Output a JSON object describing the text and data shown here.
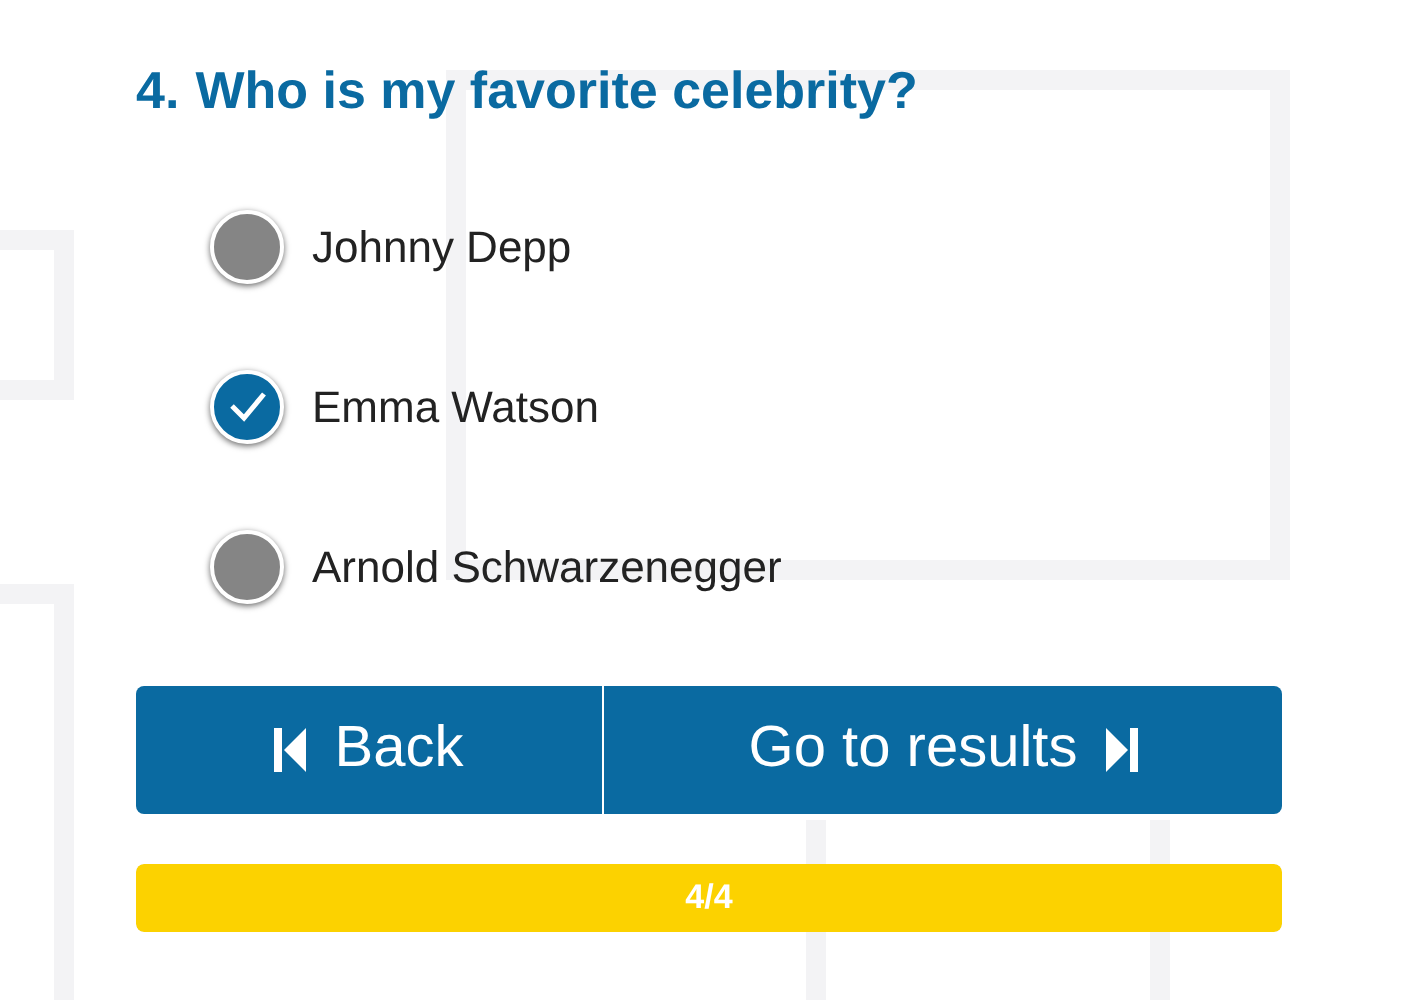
{
  "question": {
    "number": "4.",
    "text": "Who is my favorite celebrity?"
  },
  "options": [
    {
      "label": "Johnny Depp",
      "selected": false
    },
    {
      "label": "Emma Watson",
      "selected": true
    },
    {
      "label": "Arnold Schwarzenegger",
      "selected": false
    }
  ],
  "buttons": [
    {
      "kind": "back",
      "label": "Back"
    },
    {
      "kind": "next",
      "label": "Go to results"
    }
  ],
  "progress": {
    "level": 1,
    "text": "4/4"
  }
}
